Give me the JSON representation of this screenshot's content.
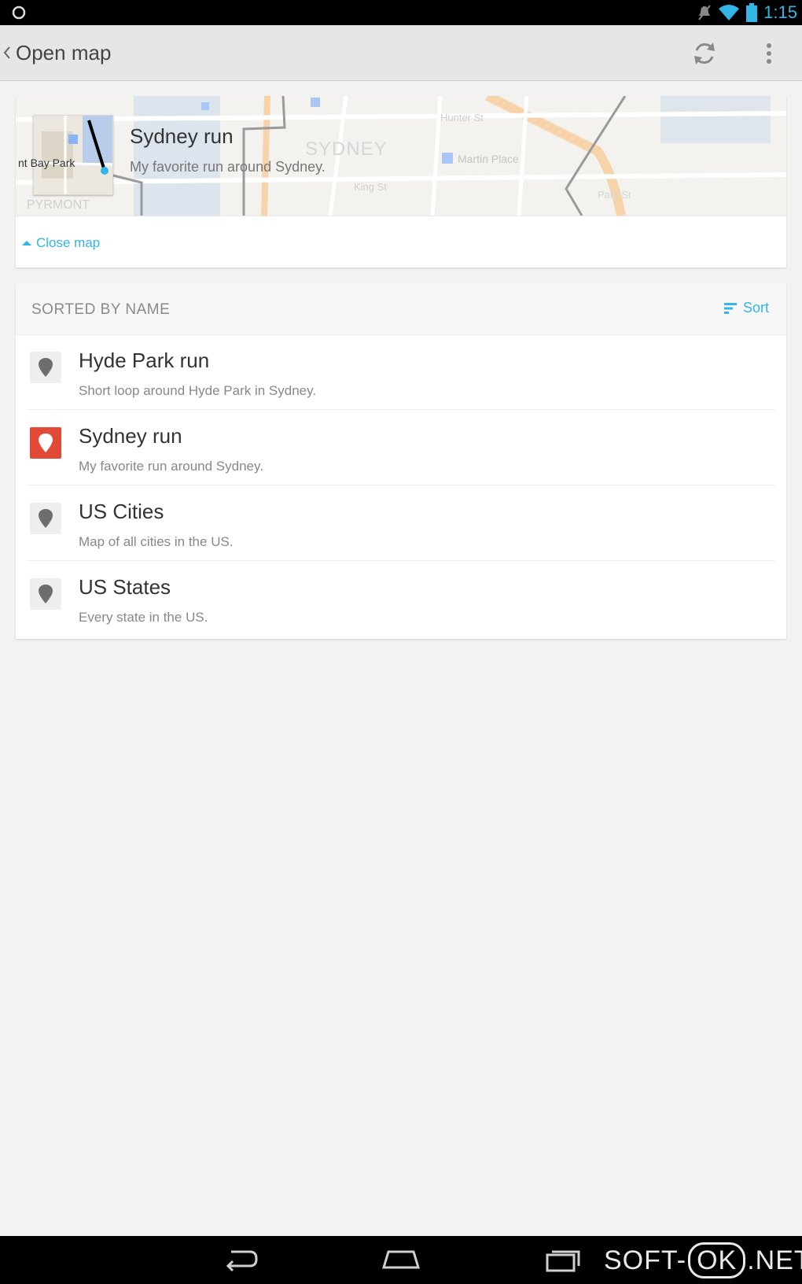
{
  "status_bar": {
    "time": "1:15",
    "icons": [
      "android-icon",
      "notification-off-icon",
      "wifi-icon",
      "battery-icon"
    ]
  },
  "action_bar": {
    "title": "Open map",
    "actions": [
      "refresh-icon",
      "overflow-menu-icon"
    ]
  },
  "map_card": {
    "title": "Sydney run",
    "description": "My favorite run around Sydney.",
    "map_labels": [
      "SYDNEY",
      "PYRMONT",
      "nt Bay Park",
      "Hunter St",
      "Martin Place",
      "King St",
      "Park St"
    ],
    "close_label": "Close map"
  },
  "list": {
    "header": "SORTED BY NAME",
    "sort_label": "Sort",
    "items": [
      {
        "title": "Hyde Park run",
        "description": "Short loop around Hyde Park in Sydney.",
        "selected": false
      },
      {
        "title": "Sydney run",
        "description": "My favorite run around Sydney.",
        "selected": true
      },
      {
        "title": "US Cities",
        "description": "Map of all cities in the US.",
        "selected": false
      },
      {
        "title": "US States",
        "description": "Every state in the US.",
        "selected": false
      }
    ]
  },
  "nav_bar": {
    "buttons": [
      "back-icon",
      "home-icon",
      "recents-icon"
    ]
  },
  "watermark": {
    "part1": "SOFT-",
    "part2": "OK",
    "part3": ".NET"
  },
  "colors": {
    "accent": "#33b5e5",
    "selected_pin": "#e24a35",
    "background": "#f2f2f2"
  }
}
